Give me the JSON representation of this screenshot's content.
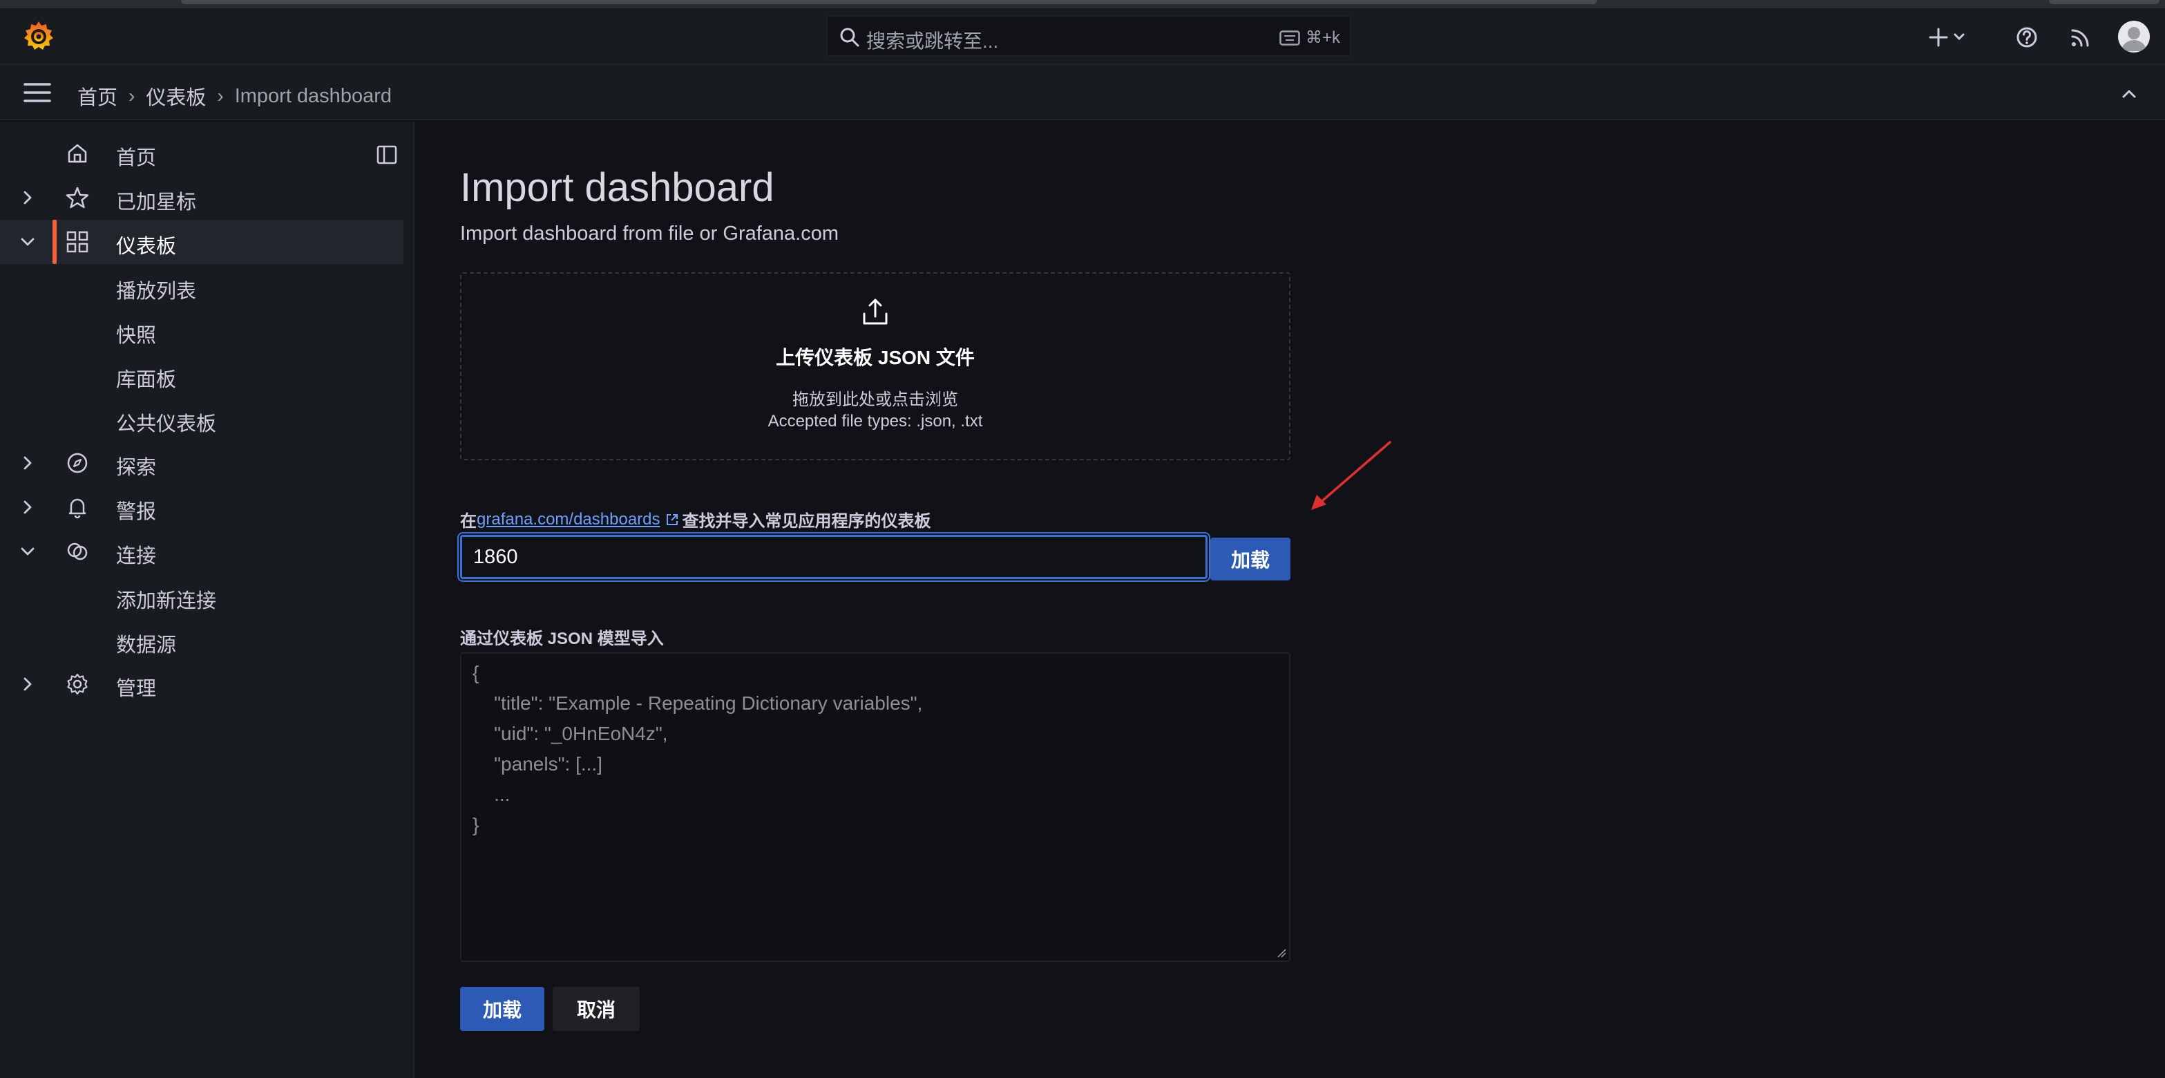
{
  "topbar": {
    "search_placeholder": "搜索或跳转至...",
    "search_shortcut": "⌘+k",
    "icons": [
      "grafana-logo-icon",
      "search-icon",
      "keyboard-icon",
      "plus-icon",
      "chevron-down-icon",
      "help-icon",
      "news-feed-icon",
      "avatar-icon"
    ]
  },
  "breadcrumb": {
    "items": [
      "首页",
      "仪表板"
    ],
    "current": "Import dashboard"
  },
  "sidebar": {
    "items": [
      {
        "label": "首页",
        "icon": "home-icon",
        "expandable": false
      },
      {
        "label": "已加星标",
        "icon": "star-icon",
        "expandable": true,
        "expanded": false
      },
      {
        "label": "仪表板",
        "icon": "apps-icon",
        "expandable": true,
        "expanded": true,
        "active": true
      },
      {
        "label": "探索",
        "icon": "compass-icon",
        "expandable": true,
        "expanded": false
      },
      {
        "label": "警报",
        "icon": "bell-icon",
        "expandable": true,
        "expanded": false
      },
      {
        "label": "连接",
        "icon": "link-icon",
        "expandable": true,
        "expanded": true
      },
      {
        "label": "管理",
        "icon": "gear-icon",
        "expandable": true,
        "expanded": false
      }
    ],
    "dashboard_children": [
      "播放列表",
      "快照",
      "库面板",
      "公共仪表板"
    ],
    "connection_children": [
      "添加新连接",
      "数据源"
    ]
  },
  "main": {
    "title": "Import dashboard",
    "subtitle": "Import dashboard from file or Grafana.com",
    "upload": {
      "title": "上传仪表板 JSON 文件",
      "hint": "拖放到此处或点击浏览",
      "accepted": "Accepted file types: .json, .txt"
    },
    "grafana_field": {
      "prefix": "在",
      "link": "grafana.com/dashboards",
      "suffix": "查找并导入常见应用程序的仪表板",
      "value": "1860",
      "load_label": "加载"
    },
    "json_field": {
      "label": "通过仪表板 JSON 模型导入",
      "placeholder_lines": [
        "{",
        "    \"title\": \"Example - Repeating Dictionary variables\",",
        "    \"uid\": \"_0HnEoN4z\",",
        "    \"panels\": [...]",
        "    ...",
        "}"
      ]
    },
    "buttons": {
      "load": "加载",
      "cancel": "取消"
    }
  },
  "colors": {
    "background": "#111217",
    "panel": "#181b1f",
    "primary": "#3d71d9",
    "active_bar": "#f55f3e",
    "annotation_arrow": "#e02f2f"
  }
}
